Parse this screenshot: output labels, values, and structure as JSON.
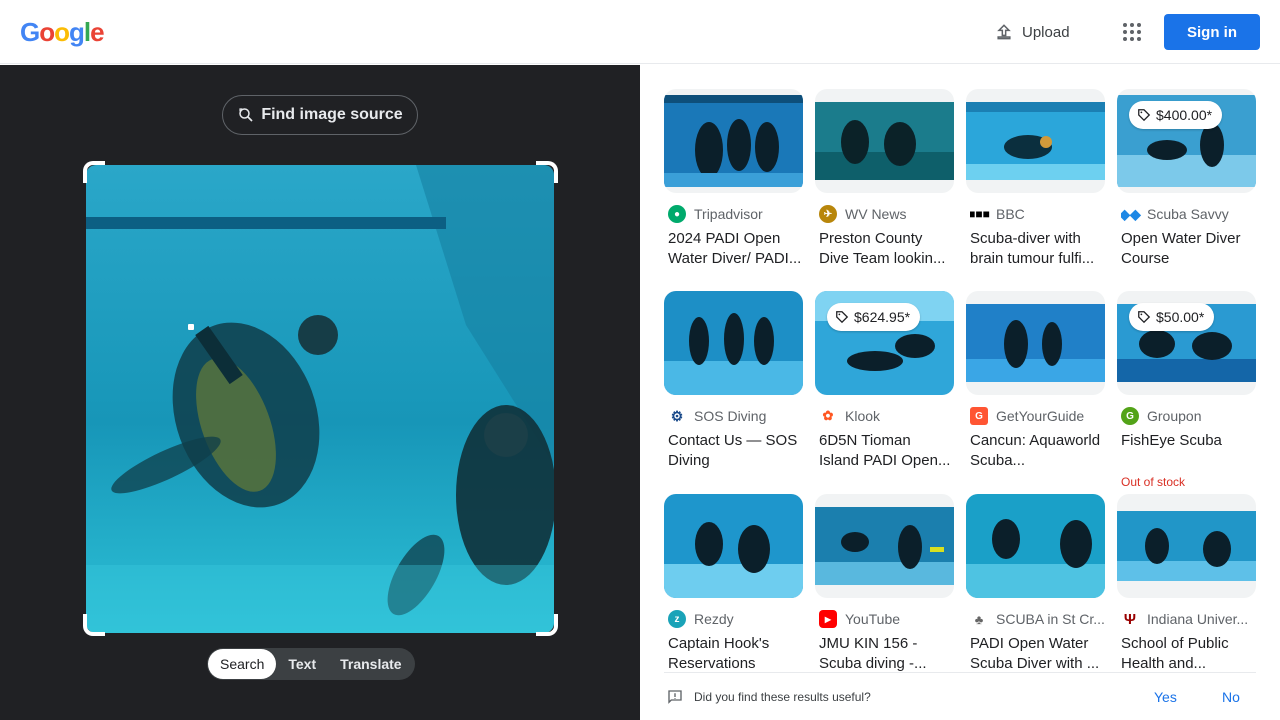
{
  "header": {
    "logo_letters": [
      "G",
      "o",
      "o",
      "g",
      "l",
      "e"
    ],
    "upload_label": "Upload",
    "signin_label": "Sign in"
  },
  "left": {
    "find_source_label": "Find image source",
    "modes": [
      "Search",
      "Text",
      "Translate"
    ],
    "active_mode": "Search"
  },
  "results": [
    {
      "source": "Tripadvisor",
      "title": "2024 PADI Open Water Diver/ PADI...",
      "price": "",
      "stock": ""
    },
    {
      "source": "WV News",
      "title": "Preston County Dive Team lookin...",
      "price": "",
      "stock": ""
    },
    {
      "source": "BBC",
      "title": "Scuba-diver with brain tumour fulfi...",
      "price": "",
      "stock": ""
    },
    {
      "source": "Scuba Savvy",
      "title": "Open Water Diver Course",
      "price": "$400.00*",
      "stock": ""
    },
    {
      "source": "SOS Diving",
      "title": "Contact Us — SOS Diving",
      "price": "",
      "stock": ""
    },
    {
      "source": "Klook",
      "title": "6D5N Tioman Island PADI Open...",
      "price": "$624.95*",
      "stock": ""
    },
    {
      "source": "GetYourGuide",
      "title": "Cancun: Aquaworld Scuba...",
      "price": "",
      "stock": ""
    },
    {
      "source": "Groupon",
      "title": "FishEye Scuba",
      "price": "$50.00*",
      "stock": "Out of stock"
    },
    {
      "source": "Rezdy",
      "title": "Captain Hook's Reservations",
      "price": "",
      "stock": ""
    },
    {
      "source": "YouTube",
      "title": "JMU KIN 156 - Scuba diving -...",
      "price": "",
      "stock": ""
    },
    {
      "source": "SCUBA in St Cr...",
      "title": "PADI Open Water Scuba Diver with ...",
      "price": "",
      "stock": ""
    },
    {
      "source": "Indiana Univer...",
      "title": "School of Public Health and...",
      "price": "",
      "stock": ""
    }
  ],
  "feedback": {
    "question": "Did you find these results useful?",
    "yes": "Yes",
    "no": "No"
  },
  "colors": {
    "accent": "#1a73e8",
    "dark_panel": "#202124",
    "out_of_stock": "#d93025"
  }
}
